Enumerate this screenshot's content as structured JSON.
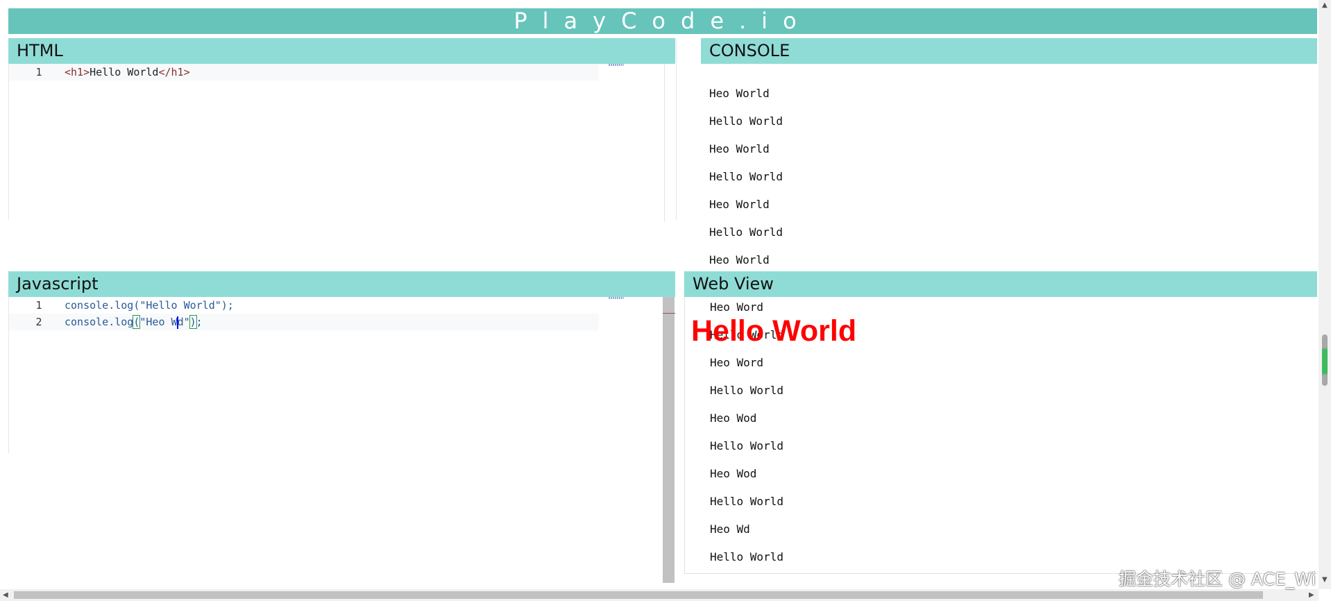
{
  "header": {
    "title": "PlayCode.io"
  },
  "panels": {
    "html": {
      "title": "HTML"
    },
    "console": {
      "title": "CONSOLE"
    },
    "javascript": {
      "title": "Javascript"
    },
    "webview": {
      "title": "Web View"
    }
  },
  "html_editor": {
    "lines": [
      {
        "number": "1",
        "tag_open": "<h1>",
        "text": "Hello World",
        "tag_close": "</h1>"
      }
    ]
  },
  "js_editor": {
    "lines": [
      {
        "number": "1",
        "code": "console.log(\"Hello World\");"
      },
      {
        "number": "2",
        "code_before_paren": "console.log",
        "paren_open": "(",
        "string_start": "\"Heo W",
        "string_end": "d\"",
        "paren_close": ")",
        "semicolon": ";"
      }
    ]
  },
  "console_output_top": [
    "Heo World",
    "Hello World",
    "Heo World",
    "Hello World",
    "Heo World",
    "Hello World",
    "Heo World"
  ],
  "console_output_bottom": [
    "Heo Word",
    "Hello World",
    "Heo Word",
    "Hello World",
    "Heo Wod",
    "Hello World",
    "Heo Wod",
    "Hello World",
    "Heo Wd",
    "Hello World"
  ],
  "webview": {
    "h1": "Hello World"
  },
  "watermark": "掘金技术社区 @ ACE_Wi",
  "colors": {
    "header": "#66c4bb",
    "panel_title": "#8fdcd6",
    "webview_heading": "#ff0000"
  }
}
